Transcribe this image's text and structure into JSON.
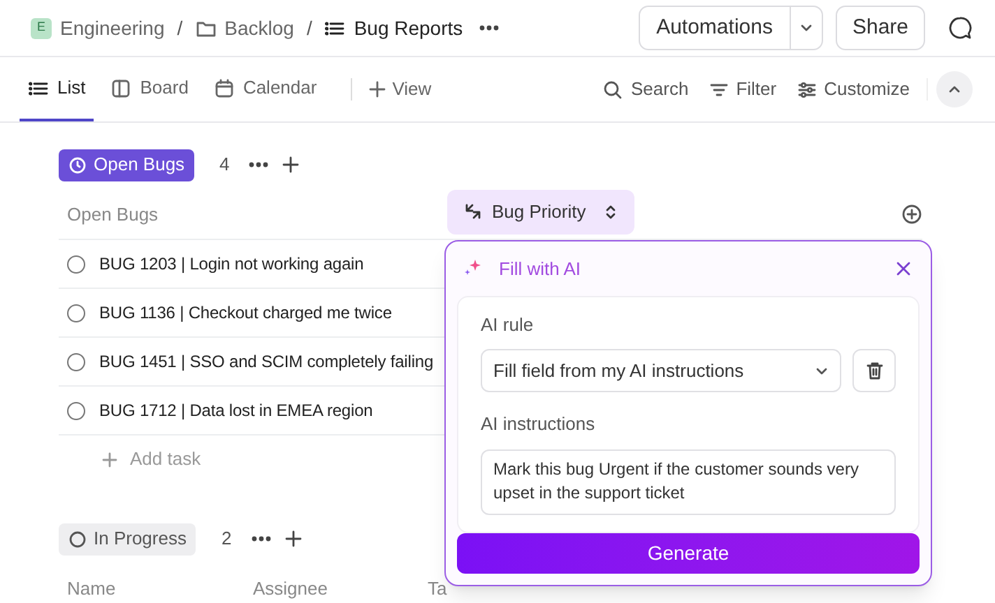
{
  "breadcrumb_separator": "/",
  "breadcrumb": [
    {
      "kind": "space",
      "badge": "E",
      "label": "Engineering"
    },
    {
      "kind": "folder",
      "label": "Backlog"
    },
    {
      "kind": "list",
      "label": "Bug Reports"
    }
  ],
  "header_buttons": {
    "automations": "Automations",
    "share": "Share"
  },
  "tabs": [
    {
      "kind": "list",
      "label": "List",
      "selected": true
    },
    {
      "kind": "board",
      "label": "Board",
      "selected": false
    },
    {
      "kind": "calendar",
      "label": "Calendar",
      "selected": false
    }
  ],
  "add_view": "View",
  "toolbar": [
    {
      "kind": "search",
      "label": "Search"
    },
    {
      "kind": "filter",
      "label": "Filter"
    },
    {
      "kind": "customize",
      "label": "Customize"
    }
  ],
  "groups": [
    {
      "status": "Open Bugs",
      "kind": "open",
      "count": "4",
      "columns": [
        "Open Bugs"
      ],
      "tasks": [
        "BUG 1203 | Login not working again",
        "BUG 1136 | Checkout charged me twice",
        "BUG 1451 | SSO and SCIM completely failing",
        "BUG 1712 | Data lost in EMEA region"
      ],
      "add_task": "Add task"
    },
    {
      "status": "In Progress",
      "kind": "progress",
      "count": "2",
      "columns": [
        "Name",
        "Assignee",
        "Ta"
      ]
    }
  ],
  "field_column": {
    "label": "Bug Priority"
  },
  "ai_popup": {
    "title": "Fill with AI",
    "rule_label": "AI rule",
    "rule_value": "Fill field from my AI instructions",
    "instructions_label": "AI instructions",
    "instructions_value": "Mark this bug Urgent if the customer sounds very upset in the support ticket",
    "button": "Generate"
  }
}
